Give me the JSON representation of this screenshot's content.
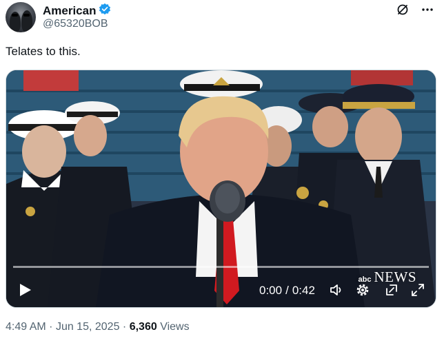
{
  "author": {
    "display_name": "American",
    "handle": "@65320BOB",
    "verified_color": "#1d9bf0"
  },
  "header_icons": [
    "grok-icon",
    "more-icon"
  ],
  "tweet": {
    "text": "Telates to this."
  },
  "video": {
    "current_time": "0:00",
    "time_separator": "/",
    "duration": "0:42",
    "progress_fraction": 0.0,
    "watermark_small": "abc",
    "watermark_large": "NEWS",
    "controls": [
      "play-icon",
      "volume-icon",
      "settings-icon",
      "pop-out-icon",
      "fullscreen-icon"
    ]
  },
  "meta": {
    "time": "4:49 AM",
    "dot1": "·",
    "date": "Jun 15, 2025",
    "dot2": "·",
    "views_count": "6,360",
    "views_label": "Views"
  }
}
